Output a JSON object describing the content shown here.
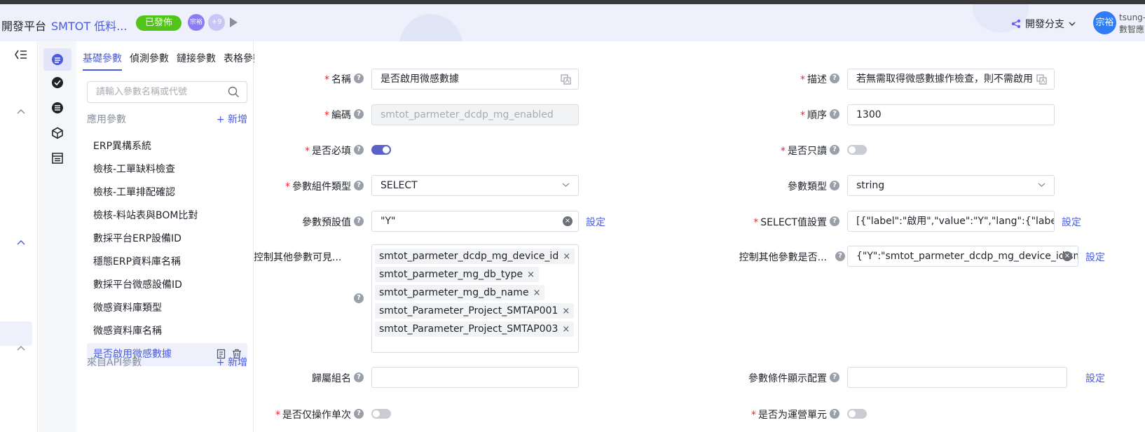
{
  "header": {
    "title": "開發平台",
    "app_name": "SMTOT 低料...",
    "status_badge": "已發佈",
    "avatars": [
      "宗裕",
      "+9"
    ],
    "branch_label": "開發分支",
    "user_avatar": "宗裕",
    "user_name": "tsung-",
    "user_org": "數智應"
  },
  "param_panel": {
    "tabs": [
      "基礎參數",
      "偵測參數",
      "鏈接參數",
      "表格參數"
    ],
    "search_placeholder": "請輸入參數名稱或代號",
    "section_app": "應用參數",
    "add_label": "+ 新增",
    "items": [
      "ERP異構系統",
      "檢核-工單缺料檢查",
      "檢核-工單排配確認",
      "檢核-料站表與BOM比對",
      "數採平台ERP設備ID",
      "穩態ERP資料庫名稱",
      "數採平台微感設備ID",
      "微感資料庫類型",
      "微感資料庫名稱",
      "是否啟用微感數據"
    ],
    "section_api": "來自API參數",
    "add_label_api": "+ 新增"
  },
  "form": {
    "name_label": "名稱",
    "name_value": "是否啟用微感數據",
    "desc_label": "描述",
    "desc_value": "若無需取得微感數據作檢查，則不需啟用",
    "code_label": "編碼",
    "code_value": "smtot_parmeter_dcdp_mg_enabled",
    "order_label": "順序",
    "order_value": "1300",
    "required_label": "是否必填",
    "readonly_label": "是否只讀",
    "component_type_label": "參數組件類型",
    "component_type_value": "SELECT",
    "param_type_label": "參數類型",
    "param_type_value": "string",
    "default_label": "參數預設值",
    "default_value": "\"Y\"",
    "setting_link": "設定",
    "select_value_label": "SELECT值設置",
    "select_value_value": "[{\"label\":\"啟用\",\"value\":\"Y\",\"lang\":{\"label\":{\"",
    "control_visible_label": "控制其他參數可見...",
    "control_tags": [
      "smtot_parmeter_dcdp_mg_device_id",
      "smtot_parmeter_mg_db_type",
      "smtot_parmeter_mg_db_name",
      "smtot_Parameter_Project_SMTAP001",
      "smtot_Parameter_Project_SMTAP003"
    ],
    "control_other_label": "控制其他參數是否...",
    "control_other_value": "{\"Y\":\"smtot_parmeter_dcdp_mg_device_id,smt",
    "group_label": "歸屬組名",
    "group_value": "",
    "condition_label": "參數條件顯示配置",
    "condition_value": "",
    "op_once_label": "是否仅操作单次",
    "ops_unit_label": "是否为運營單元"
  }
}
